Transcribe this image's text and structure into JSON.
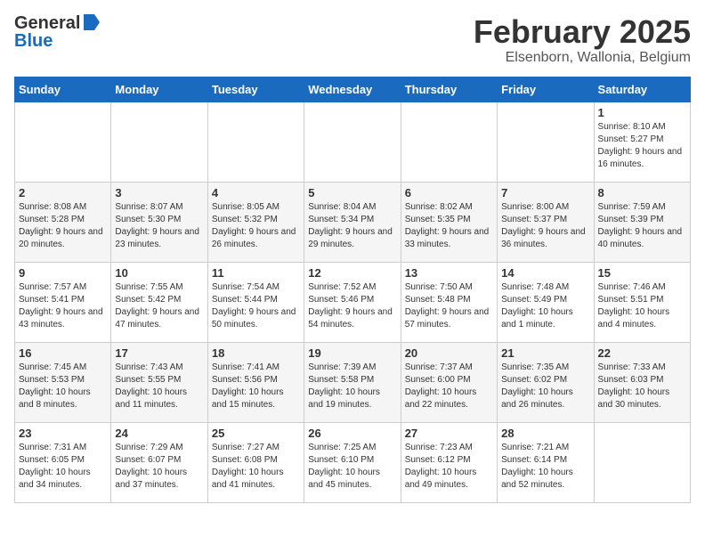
{
  "header": {
    "logo_general": "General",
    "logo_blue": "Blue",
    "title": "February 2025",
    "location": "Elsenborn, Wallonia, Belgium"
  },
  "weekdays": [
    "Sunday",
    "Monday",
    "Tuesday",
    "Wednesday",
    "Thursday",
    "Friday",
    "Saturday"
  ],
  "weeks": [
    [
      {
        "day": "",
        "info": ""
      },
      {
        "day": "",
        "info": ""
      },
      {
        "day": "",
        "info": ""
      },
      {
        "day": "",
        "info": ""
      },
      {
        "day": "",
        "info": ""
      },
      {
        "day": "",
        "info": ""
      },
      {
        "day": "1",
        "info": "Sunrise: 8:10 AM\nSunset: 5:27 PM\nDaylight: 9 hours and 16 minutes."
      }
    ],
    [
      {
        "day": "2",
        "info": "Sunrise: 8:08 AM\nSunset: 5:28 PM\nDaylight: 9 hours and 20 minutes."
      },
      {
        "day": "3",
        "info": "Sunrise: 8:07 AM\nSunset: 5:30 PM\nDaylight: 9 hours and 23 minutes."
      },
      {
        "day": "4",
        "info": "Sunrise: 8:05 AM\nSunset: 5:32 PM\nDaylight: 9 hours and 26 minutes."
      },
      {
        "day": "5",
        "info": "Sunrise: 8:04 AM\nSunset: 5:34 PM\nDaylight: 9 hours and 29 minutes."
      },
      {
        "day": "6",
        "info": "Sunrise: 8:02 AM\nSunset: 5:35 PM\nDaylight: 9 hours and 33 minutes."
      },
      {
        "day": "7",
        "info": "Sunrise: 8:00 AM\nSunset: 5:37 PM\nDaylight: 9 hours and 36 minutes."
      },
      {
        "day": "8",
        "info": "Sunrise: 7:59 AM\nSunset: 5:39 PM\nDaylight: 9 hours and 40 minutes."
      }
    ],
    [
      {
        "day": "9",
        "info": "Sunrise: 7:57 AM\nSunset: 5:41 PM\nDaylight: 9 hours and 43 minutes."
      },
      {
        "day": "10",
        "info": "Sunrise: 7:55 AM\nSunset: 5:42 PM\nDaylight: 9 hours and 47 minutes."
      },
      {
        "day": "11",
        "info": "Sunrise: 7:54 AM\nSunset: 5:44 PM\nDaylight: 9 hours and 50 minutes."
      },
      {
        "day": "12",
        "info": "Sunrise: 7:52 AM\nSunset: 5:46 PM\nDaylight: 9 hours and 54 minutes."
      },
      {
        "day": "13",
        "info": "Sunrise: 7:50 AM\nSunset: 5:48 PM\nDaylight: 9 hours and 57 minutes."
      },
      {
        "day": "14",
        "info": "Sunrise: 7:48 AM\nSunset: 5:49 PM\nDaylight: 10 hours and 1 minute."
      },
      {
        "day": "15",
        "info": "Sunrise: 7:46 AM\nSunset: 5:51 PM\nDaylight: 10 hours and 4 minutes."
      }
    ],
    [
      {
        "day": "16",
        "info": "Sunrise: 7:45 AM\nSunset: 5:53 PM\nDaylight: 10 hours and 8 minutes."
      },
      {
        "day": "17",
        "info": "Sunrise: 7:43 AM\nSunset: 5:55 PM\nDaylight: 10 hours and 11 minutes."
      },
      {
        "day": "18",
        "info": "Sunrise: 7:41 AM\nSunset: 5:56 PM\nDaylight: 10 hours and 15 minutes."
      },
      {
        "day": "19",
        "info": "Sunrise: 7:39 AM\nSunset: 5:58 PM\nDaylight: 10 hours and 19 minutes."
      },
      {
        "day": "20",
        "info": "Sunrise: 7:37 AM\nSunset: 6:00 PM\nDaylight: 10 hours and 22 minutes."
      },
      {
        "day": "21",
        "info": "Sunrise: 7:35 AM\nSunset: 6:02 PM\nDaylight: 10 hours and 26 minutes."
      },
      {
        "day": "22",
        "info": "Sunrise: 7:33 AM\nSunset: 6:03 PM\nDaylight: 10 hours and 30 minutes."
      }
    ],
    [
      {
        "day": "23",
        "info": "Sunrise: 7:31 AM\nSunset: 6:05 PM\nDaylight: 10 hours and 34 minutes."
      },
      {
        "day": "24",
        "info": "Sunrise: 7:29 AM\nSunset: 6:07 PM\nDaylight: 10 hours and 37 minutes."
      },
      {
        "day": "25",
        "info": "Sunrise: 7:27 AM\nSunset: 6:08 PM\nDaylight: 10 hours and 41 minutes."
      },
      {
        "day": "26",
        "info": "Sunrise: 7:25 AM\nSunset: 6:10 PM\nDaylight: 10 hours and 45 minutes."
      },
      {
        "day": "27",
        "info": "Sunrise: 7:23 AM\nSunset: 6:12 PM\nDaylight: 10 hours and 49 minutes."
      },
      {
        "day": "28",
        "info": "Sunrise: 7:21 AM\nSunset: 6:14 PM\nDaylight: 10 hours and 52 minutes."
      },
      {
        "day": "",
        "info": ""
      }
    ]
  ]
}
